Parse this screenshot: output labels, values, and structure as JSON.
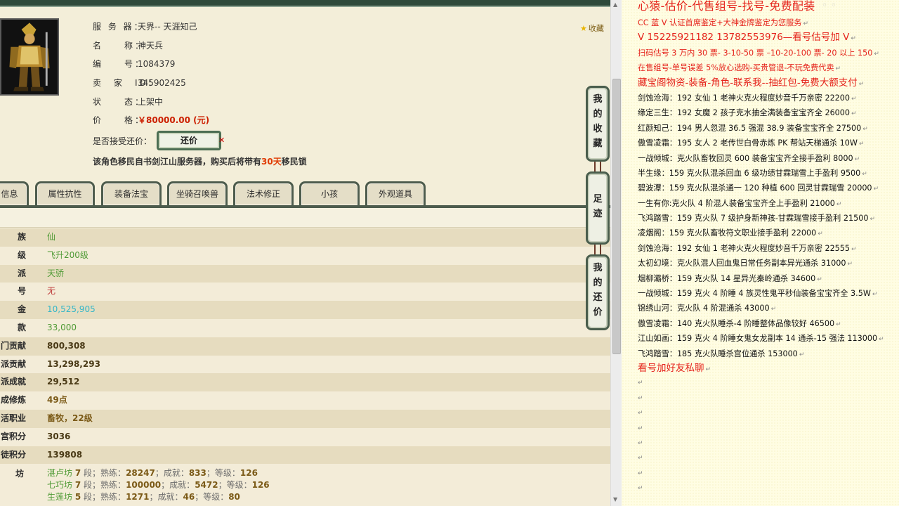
{
  "favorite_link": "收藏",
  "info": [
    {
      "label": "服 务 器：",
      "value": "天界-- 天涯知己"
    },
    {
      "label": "名　　称：",
      "value": "神天兵"
    },
    {
      "label": "编　　号：",
      "value": "1084379"
    },
    {
      "label": "卖　家　ID：",
      "value": "345902425"
    },
    {
      "label": "状　　态：",
      "value": "上架中"
    },
    {
      "label": "价　　格：",
      "value": "￥80000.00 (元)"
    }
  ],
  "bargain": {
    "label": "是否接受还价：",
    "button": "还价"
  },
  "notice": {
    "before": "该角色移民自书剑江山服务器，购买后将带有",
    "days": "30天",
    "after": "移民锁"
  },
  "tabs": [
    "信息",
    "属性抗性",
    "装备法宝",
    "坐骑召唤兽",
    "法术修正",
    "小孩",
    "外观道具"
  ],
  "rows": [
    {
      "k": "族",
      "v": "仙"
    },
    {
      "k": "级",
      "v": "飞升200级"
    },
    {
      "k": "派",
      "v": "天骄"
    },
    {
      "k": "号",
      "v": "无"
    },
    {
      "k": "金",
      "v": "10,525,905"
    },
    {
      "k": "款",
      "v": "33,000"
    },
    {
      "k": "门贡献",
      "v": "800,308"
    },
    {
      "k": "派贡献",
      "v": "13,298,293"
    },
    {
      "k": "派成就",
      "v": "29,512"
    },
    {
      "k": "成修炼",
      "v": "49点"
    },
    {
      "k": "活职业",
      "v": "畜牧，22级"
    },
    {
      "k": "宫积分",
      "v": "3036"
    },
    {
      "k": "徒积分",
      "v": "139808"
    }
  ],
  "fang": {
    "label": "坊",
    "lines": [
      {
        "name": "湛卢坊",
        "rank": "7",
        "shu": "28247",
        "cj": "833",
        "dj": "126"
      },
      {
        "name": "七巧坊",
        "rank": "7",
        "shu": "100000",
        "cj": "5472",
        "dj": "126"
      },
      {
        "name": "生莲坊",
        "rank": "5",
        "shu": "1271",
        "cj": "46",
        "dj": "80"
      }
    ],
    "w_duan": "段",
    "w_shu": "；熟练：",
    "w_cj": "；成就：",
    "w_dj": "；等级："
  },
  "side_buttons": [
    {
      "chars": [
        "我",
        "的",
        "收",
        "藏"
      ]
    },
    {
      "chars": [
        "足",
        "迹"
      ]
    },
    {
      "chars": [
        "我",
        "的",
        "还",
        "价"
      ]
    }
  ],
  "doc": {
    "title": "心猿-估价-代售组号-找号-免费配装",
    "lines": [
      {
        "t": "CC 蓝 V 认证首席鉴定+大神金牌鉴定为您服务",
        "c": "red"
      },
      {
        "t": "V 15225921182     13782553976—看号估号加 V",
        "c": "red",
        "big": true
      },
      {
        "t": "扫码估号 3 万内 30 票- 3-10-50 票  –10-20-100 票- 20 以上 150",
        "c": "red"
      },
      {
        "t": "在售组号-单号误差 5%放心选购-买贵管退-不玩免费代卖",
        "c": "red"
      },
      {
        "t": "藏宝阁物资-装备-角色-联系我--抽红包-免费大额支付",
        "c": "red",
        "big": true
      },
      {
        "t": "剑蚀沧海：192 女仙 1 老神火克火程度妙音千万亲密 22200"
      },
      {
        "t": "缘定三生：192 女魔 2 孩子克水抽全满装备宝宝齐全 26000"
      },
      {
        "t": "红颜知己：194 男人忽混 36.5 强混 38.9 装备宝宝齐全 27500"
      },
      {
        "t": "傲雪凌霜：195 女人 2 老传世白骨赤炼 PK 帮站天梯通杀 10W"
      },
      {
        "t": "一战倾城：克火队畜牧回灵 600 装备宝宝齐全接手盈利 8000"
      },
      {
        "t": "半生缘：159 克火队混杀回血 6 级功绩甘霖瑞雪上手盈利 9500"
      },
      {
        "t": "碧波潭：159 克火队混杀通一 120 种植 600 回灵甘霖瑞雪 20000"
      },
      {
        "t": "一生有你:克火队 4 阶混人装备宝宝齐全上手盈利 21000"
      },
      {
        "t": "飞鸿踏雪：159 克火队 7 级护身新神孩-甘霖瑞雪接手盈利 21500"
      },
      {
        "t": "凌烟阁：159 克火队畜牧符文职业接手盈利 22000"
      },
      {
        "t": "剑蚀沧海：192 女仙 1 老神火克火程度妙音千万亲密 22555"
      },
      {
        "t": "太初幻境：克火队混人回血鬼日常任务副本异光通杀 31000"
      },
      {
        "t": "烟柳灞桥：159 克火队 14 星异光秦岭通杀 34600"
      },
      {
        "t": "一战倾城：159 克火 4 阶睡 4 族灵性鬼平秒仙装备宝宝齐全 3.5W"
      },
      {
        "t": "锦绣山河：克火队 4 阶混通杀 43000"
      },
      {
        "t": "傲雪凌霜：140 克火队睡杀-4 阶睡整体品像较好 46500"
      },
      {
        "t": "江山如画：159 克火 4 阶睡女鬼女龙副本 14 通杀-15 强法 113000"
      },
      {
        "t": "飞鸿踏雪：185 克火队睡杀宫位通杀 153000"
      },
      {
        "t": "看号加好友私聊",
        "c": "red",
        "big": true
      }
    ],
    "para_mark": "↵",
    "empty_lines": 8
  }
}
